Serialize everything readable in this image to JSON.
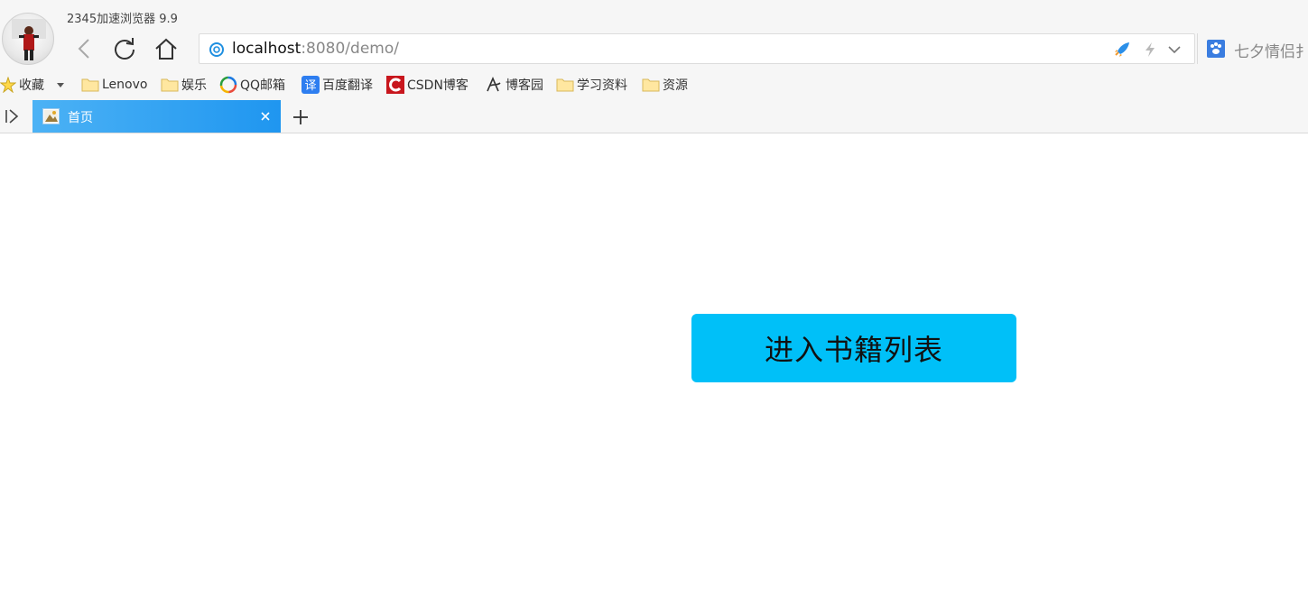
{
  "window": {
    "title": "2345加速浏览器 9.9"
  },
  "address_bar": {
    "host": "localhost",
    "rest": ":8080/demo/"
  },
  "search_extension": {
    "text": "七夕情侣扌"
  },
  "bookmarks": [
    {
      "label": "收藏",
      "icon": "star-icon"
    },
    {
      "label": "",
      "icon": "dropdown-caret-icon"
    },
    {
      "label": "Lenovo",
      "icon": "folder-icon"
    },
    {
      "label": "娱乐",
      "icon": "folder-icon"
    },
    {
      "label": "QQ邮箱",
      "icon": "qq-mail-icon"
    },
    {
      "label": "百度翻译",
      "icon": "baidu-translate-icon"
    },
    {
      "label": "CSDN博客",
      "icon": "csdn-icon"
    },
    {
      "label": "博客园",
      "icon": "cnblogs-icon"
    },
    {
      "label": "学习资料",
      "icon": "folder-icon"
    },
    {
      "label": "资源",
      "icon": "folder-icon"
    }
  ],
  "tabs": [
    {
      "label": "首页",
      "active": true
    }
  ],
  "page": {
    "enter_button_label": "进入书籍列表"
  },
  "colors": {
    "tab_active": "#1f96f0",
    "button_bg": "#00c0f8"
  }
}
